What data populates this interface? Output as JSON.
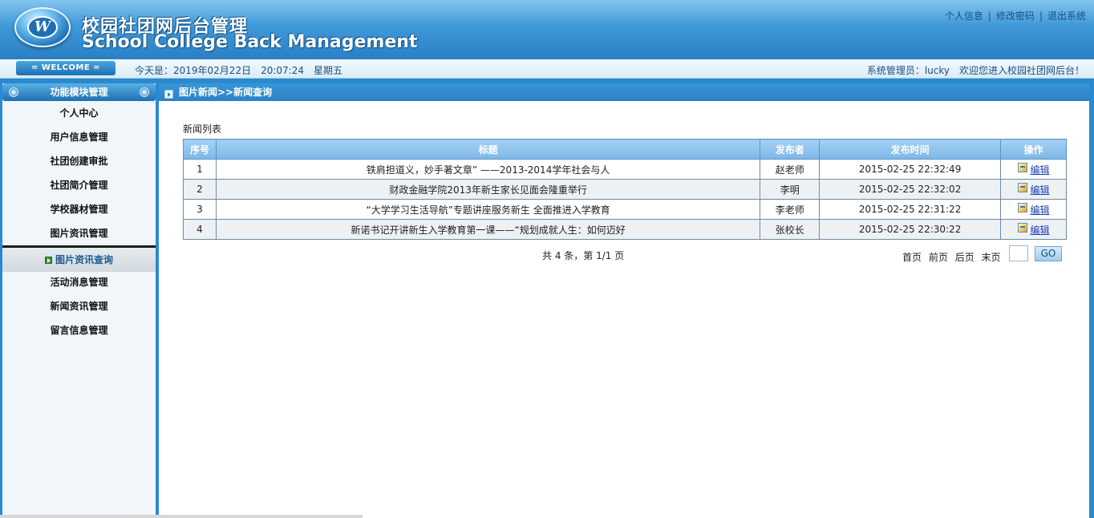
{
  "header": {
    "logo_letter": "W",
    "title_cn": "校园社团网后台管理",
    "title_en": "School College Back Management",
    "links": [
      "个人信息",
      "修改密码",
      "退出系统"
    ]
  },
  "infobar": {
    "welcome": "= WELCOME =",
    "date": "今天是：2019年02月22日　20:07:24　星期五",
    "admin": "系统管理员：lucky　欢迎您进入校园社团网后台！"
  },
  "sidebar": {
    "title": "功能模块管理",
    "items": [
      {
        "label": "个人中心"
      },
      {
        "label": "用户信息管理"
      },
      {
        "label": "社团创建审批"
      },
      {
        "label": "社团简介管理"
      },
      {
        "label": "学校器材管理"
      },
      {
        "label": "图片资讯管理"
      },
      {
        "label": "图片资讯查询"
      },
      {
        "label": "活动消息管理"
      },
      {
        "label": "新闻资讯管理"
      },
      {
        "label": "留言信息管理"
      }
    ],
    "active_index": 6
  },
  "content": {
    "breadcrumb": "图片新闻>>新闻查询",
    "list_caption": "新闻列表",
    "columns": [
      "序号",
      "标题",
      "发布者",
      "发布时间",
      "操作"
    ],
    "rows": [
      {
        "no": "1",
        "title": "铁肩担道义，妙手著文章” ——2013-2014学年社会与人",
        "author": "赵老师",
        "time": "2015-02-25 22:32:49",
        "action": "编辑"
      },
      {
        "no": "2",
        "title": "财政金融学院2013年新生家长见面会隆重举行",
        "author": "李明",
        "time": "2015-02-25 22:32:02",
        "action": "编辑"
      },
      {
        "no": "3",
        "title": "“大学学习生活导航”专题讲座服务新生 全面推进入学教育",
        "author": "李老师",
        "time": "2015-02-25 22:31:22",
        "action": "编辑"
      },
      {
        "no": "4",
        "title": "新诺书记开讲新生入学教育第一课——“规划成就人生：如何迈好",
        "author": "张校长",
        "time": "2015-02-25 22:30:22",
        "action": "编辑"
      }
    ],
    "pager": {
      "summary": "共 4 条，第 1/1 页",
      "first": "首页",
      "prev": "前页",
      "next": "后页",
      "last": "末页",
      "go": "GO"
    }
  }
}
